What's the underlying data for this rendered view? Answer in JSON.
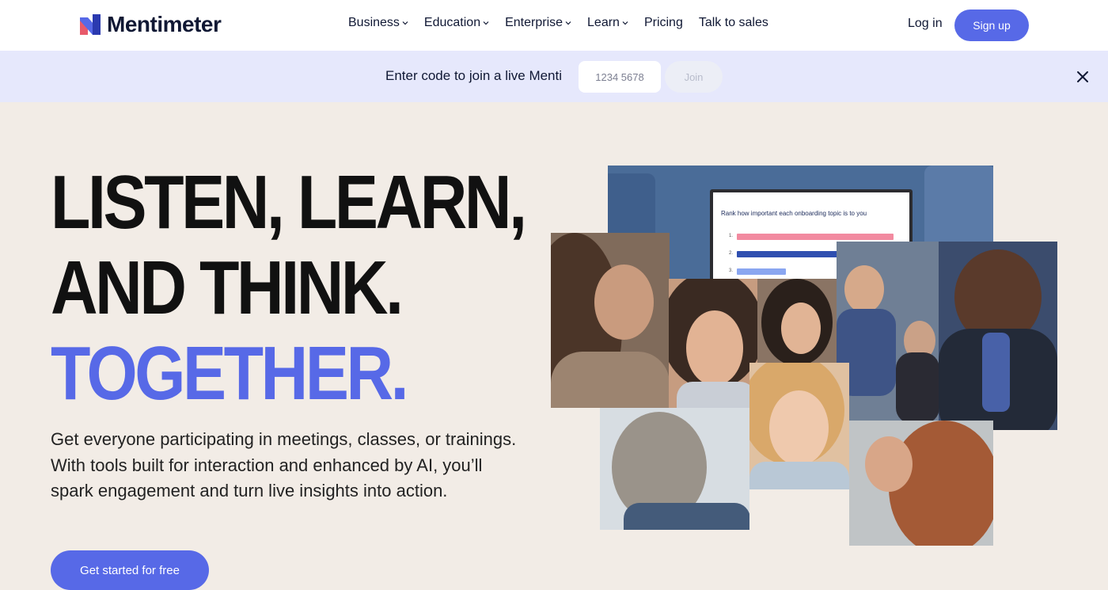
{
  "brand": {
    "name": "Mentimeter",
    "accent": "#5769e7"
  },
  "nav": {
    "items": [
      {
        "label": "Business",
        "dropdown": true
      },
      {
        "label": "Education",
        "dropdown": true
      },
      {
        "label": "Enterprise",
        "dropdown": true
      },
      {
        "label": "Learn",
        "dropdown": true
      },
      {
        "label": "Pricing",
        "dropdown": false
      },
      {
        "label": "Talk to sales",
        "dropdown": false
      }
    ],
    "login": "Log in",
    "signup": "Sign up"
  },
  "join_bar": {
    "text": "Enter code to join a live Menti",
    "placeholder": "1234 5678",
    "button": "Join"
  },
  "hero": {
    "line1": "LISTEN, LEARN,",
    "line2": "AND THINK.",
    "line3": "TOGETHER.",
    "subtext": "Get everyone participating in meetings, classes, or trainings. With tools built for interaction and enhanced by AI, you’ll spark engagement and turn live insights into action.",
    "cta": "Get started for free"
  },
  "slide": {
    "question": "Rank how important each onboarding topic is to you",
    "ranks": [
      "1.",
      "2.",
      "3."
    ]
  }
}
